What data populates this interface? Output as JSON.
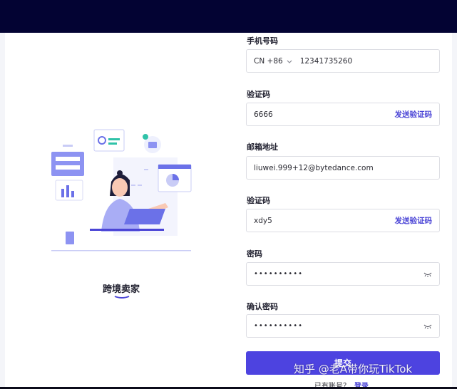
{
  "illustration": {
    "caption": "跨境卖家"
  },
  "form": {
    "phone": {
      "label": "手机号码",
      "country_code": "CN +86",
      "value": "12341735260"
    },
    "verification_code_1": {
      "label": "验证码",
      "value": "6666",
      "send_label": "发送验证码"
    },
    "email": {
      "label": "邮箱地址",
      "value": "liuwei.999+12@bytedance.com"
    },
    "verification_code_2": {
      "label": "验证码",
      "value": "xdy5",
      "send_label": "发送验证码"
    },
    "password": {
      "label": "密码",
      "masked": "••••••••••"
    },
    "confirm_password": {
      "label": "确认密码",
      "masked": "••••••••••"
    },
    "submit_label": "提交",
    "have_account_text": "已有账号？",
    "login_link": "登录"
  },
  "watermark": "知乎 @老A带你玩TikTok",
  "colors": {
    "topbar": "#030333",
    "accent": "#4d43e0",
    "link": "#4b45d6"
  }
}
